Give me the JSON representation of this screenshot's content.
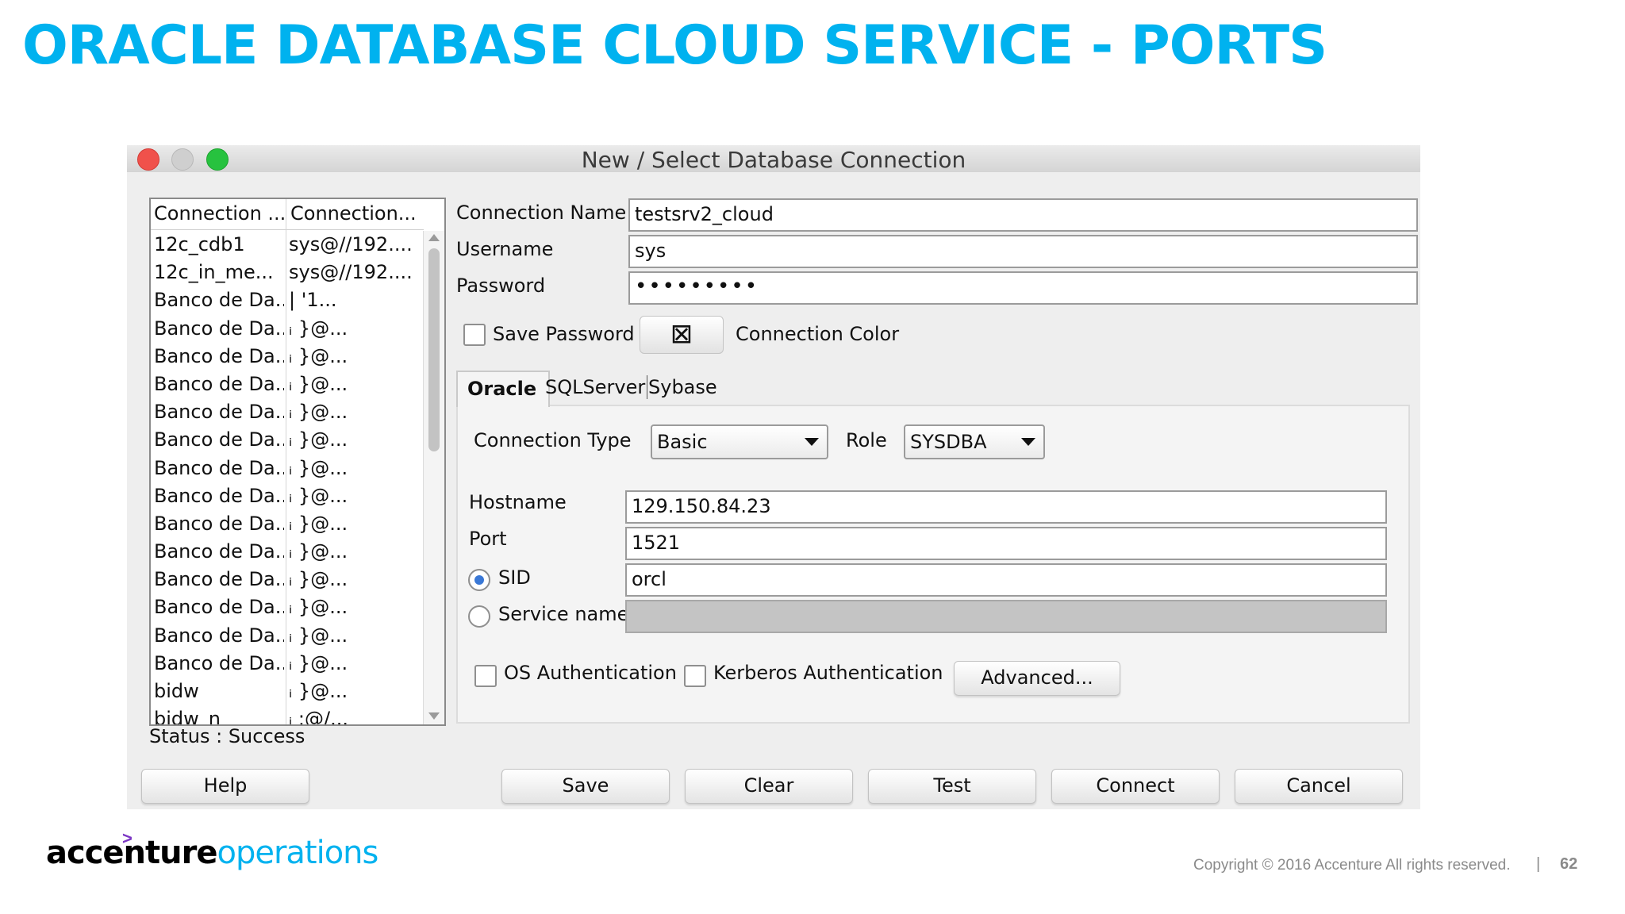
{
  "slide": {
    "title": "ORACLE DATABASE CLOUD SERVICE - PORTS",
    "accent_color": "#00b2ef"
  },
  "window": {
    "title": "New / Select Database Connection",
    "traffic_lights": [
      "close",
      "minimize",
      "zoom"
    ]
  },
  "connection_list": {
    "headers": [
      "Connection ...",
      "Connection..."
    ],
    "rows": [
      {
        "name": "12c_cdb1",
        "conn": "sys@//192...."
      },
      {
        "name": "12c_in_me...",
        "conn": "sys@//192...."
      },
      {
        "name": "Banco de Da...",
        "conn": "|             '1..."
      },
      {
        "name": "Banco de Da...",
        "conn": "ᵢ             }@..."
      },
      {
        "name": "Banco de Da...",
        "conn": "ᵢ             }@..."
      },
      {
        "name": "Banco de Da...",
        "conn": "ᵢ             }@..."
      },
      {
        "name": "Banco de Da...",
        "conn": "ᵢ             }@..."
      },
      {
        "name": "Banco de Da...",
        "conn": "ᵢ             }@..."
      },
      {
        "name": "Banco de Da...",
        "conn": "ᵢ             }@..."
      },
      {
        "name": "Banco de Da...",
        "conn": "ᵢ             }@..."
      },
      {
        "name": "Banco de Da...",
        "conn": "ᵢ             }@..."
      },
      {
        "name": "Banco de Da...",
        "conn": "ᵢ             }@..."
      },
      {
        "name": "Banco de Da...",
        "conn": "ᵢ             }@..."
      },
      {
        "name": "Banco de Da...",
        "conn": "ᵢ             }@..."
      },
      {
        "name": "Banco de Da...",
        "conn": "ᵢ             }@..."
      },
      {
        "name": "Banco de Da...",
        "conn": "ᵢ             }@..."
      },
      {
        "name": "bidw",
        "conn": "ᵢ             }@..."
      },
      {
        "name": "bidw_n",
        "conn": "ᵢ             ;@/..."
      }
    ]
  },
  "status": "Status : Success",
  "form": {
    "connection_name_label": "Connection Name",
    "connection_name_value": "testsrv2_cloud",
    "username_label": "Username",
    "username_value": "sys",
    "password_label": "Password",
    "password_value": "•••••••••",
    "save_password_label": "Save Password",
    "save_password_checked": false,
    "connection_color_label": "Connection Color",
    "connection_color_icon": "no-color-icon",
    "tabs": [
      "Oracle",
      "SQLServer",
      "Sybase"
    ],
    "active_tab": "Oracle",
    "connection_type_label": "Connection Type",
    "connection_type_value": "Basic",
    "role_label": "Role",
    "role_value": "SYSDBA",
    "hostname_label": "Hostname",
    "hostname_value": "129.150.84.23",
    "port_label": "Port",
    "port_value": "1521",
    "sid_label": "SID",
    "sid_value": "orcl",
    "sid_selected": true,
    "service_name_label": "Service name",
    "service_name_value": "",
    "os_auth_label": "OS Authentication",
    "kerberos_auth_label": "Kerberos Authentication",
    "advanced_label": "Advanced..."
  },
  "buttons": {
    "help": "Help",
    "save": "Save",
    "clear": "Clear",
    "test": "Test",
    "connect": "Connect",
    "cancel": "Cancel"
  },
  "footer": {
    "logo_bold": "accenture",
    "logo_light": "operations",
    "logo_arrow": ">",
    "copyright": "Copyright © 2016 Accenture  All rights reserved.",
    "separator": "|",
    "page_number": "62"
  }
}
